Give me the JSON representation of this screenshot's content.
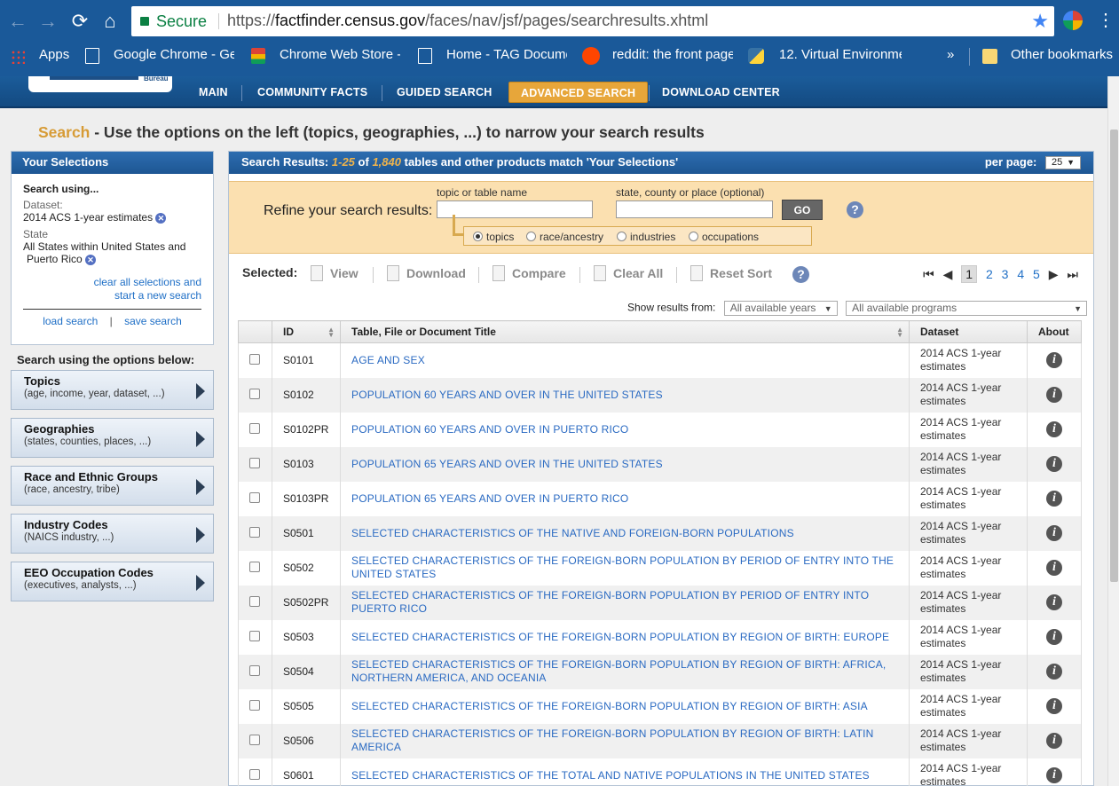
{
  "browser": {
    "secure_label": "Secure",
    "url_scheme": "https://",
    "url_host": "factfinder.census.gov",
    "url_path": "/faces/nav/jsf/pages/searchresults.xhtml",
    "bookmarks": [
      {
        "label": "Apps"
      },
      {
        "label": "Google Chrome - Ge"
      },
      {
        "label": "Chrome Web Store -"
      },
      {
        "label": "Home - TAG Docume"
      },
      {
        "label": "reddit: the front page"
      },
      {
        "label": "12. Virtual Environme"
      },
      {
        "label": "»"
      },
      {
        "label": "Other bookmarks"
      }
    ]
  },
  "site": {
    "logo_text": "Bureau",
    "nav": [
      "MAIN",
      "COMMUNITY FACTS",
      "GUIDED SEARCH",
      "ADVANCED SEARCH",
      "DOWNLOAD CENTER"
    ]
  },
  "heading": {
    "accent": "Search",
    "text": " - Use the options on the left (topics, geographies, ...) to narrow your search results"
  },
  "selections": {
    "title": "Your Selections",
    "search_using": "Search using...",
    "dataset_label": "Dataset:",
    "dataset_value": "2014 ACS 1-year estimates",
    "state_label": "State",
    "state_value_1": "All States within United States and",
    "state_value_2": "Puerto Rico",
    "clear_1": "clear all selections and",
    "clear_2": "start a new search",
    "load": "load search",
    "sep": "|",
    "save": "save search"
  },
  "options": {
    "heading": "Search using the options below:",
    "items": [
      {
        "title": "Topics",
        "sub": "(age, income, year, dataset, ...)"
      },
      {
        "title": "Geographies",
        "sub": "(states, counties, places, ...)"
      },
      {
        "title": "Race and Ethnic Groups",
        "sub": "(race, ancestry, tribe)"
      },
      {
        "title": "Industry Codes",
        "sub": "(NAICS industry, ...)"
      },
      {
        "title": "EEO Occupation Codes",
        "sub": "(executives, analysts, ...)"
      }
    ]
  },
  "results": {
    "label": "Search Results:",
    "range": "1-25",
    "of": "of",
    "total": "1,840",
    "suffix": "tables and other products match 'Your Selections'",
    "per_page_label": "per page:",
    "per_page_value": "25"
  },
  "refine": {
    "label": "Refine your search results:",
    "topic_caption": "topic or table name",
    "geo_caption": "state, county or place (optional)",
    "go": "GO",
    "radios": [
      {
        "label": "topics",
        "checked": true
      },
      {
        "label": "race/ancestry",
        "checked": false
      },
      {
        "label": "industries",
        "checked": false
      },
      {
        "label": "occupations",
        "checked": false
      }
    ]
  },
  "actions": {
    "selected": "Selected:",
    "view": "View",
    "download": "Download",
    "compare": "Compare",
    "clear_all": "Clear All",
    "reset_sort": "Reset Sort",
    "pages": [
      "1",
      "2",
      "3",
      "4",
      "5"
    ]
  },
  "filters": {
    "label": "Show results from:",
    "years": "All available years",
    "programs": "All available programs"
  },
  "table": {
    "columns": [
      "ID",
      "Table, File or Document Title",
      "Dataset",
      "About"
    ],
    "rows": [
      {
        "id": "S0101",
        "title": "AGE AND SEX",
        "ds1": "2014 ACS 1-year",
        "ds2": "estimates"
      },
      {
        "id": "S0102",
        "title": "POPULATION 60 YEARS AND OVER IN THE UNITED STATES",
        "ds1": "2014 ACS 1-year",
        "ds2": "estimates"
      },
      {
        "id": "S0102PR",
        "title": "POPULATION 60 YEARS AND OVER IN PUERTO RICO",
        "ds1": "2014 ACS 1-year",
        "ds2": "estimates"
      },
      {
        "id": "S0103",
        "title": "POPULATION 65 YEARS AND OVER IN THE UNITED STATES",
        "ds1": "2014 ACS 1-year",
        "ds2": "estimates"
      },
      {
        "id": "S0103PR",
        "title": "POPULATION 65 YEARS AND OVER IN PUERTO RICO",
        "ds1": "2014 ACS 1-year",
        "ds2": "estimates"
      },
      {
        "id": "S0501",
        "title": "SELECTED CHARACTERISTICS OF THE NATIVE AND FOREIGN-BORN POPULATIONS",
        "ds1": "2014 ACS 1-year",
        "ds2": "estimates"
      },
      {
        "id": "S0502",
        "title": "SELECTED CHARACTERISTICS OF THE FOREIGN-BORN POPULATION BY PERIOD OF ENTRY INTO THE UNITED STATES",
        "ds1": "2014 ACS 1-year",
        "ds2": "estimates"
      },
      {
        "id": "S0502PR",
        "title": "SELECTED CHARACTERISTICS OF THE FOREIGN-BORN POPULATION BY PERIOD OF ENTRY INTO PUERTO RICO",
        "ds1": "2014 ACS 1-year",
        "ds2": "estimates"
      },
      {
        "id": "S0503",
        "title": "SELECTED CHARACTERISTICS OF THE FOREIGN-BORN POPULATION BY REGION OF BIRTH: EUROPE",
        "ds1": "2014 ACS 1-year",
        "ds2": "estimates"
      },
      {
        "id": "S0504",
        "title": "SELECTED CHARACTERISTICS OF THE FOREIGN-BORN POPULATION BY REGION OF BIRTH: AFRICA, NORTHERN AMERICA, AND OCEANIA",
        "ds1": "2014 ACS 1-year",
        "ds2": "estimates"
      },
      {
        "id": "S0505",
        "title": "SELECTED CHARACTERISTICS OF THE FOREIGN-BORN POPULATION BY REGION OF BIRTH: ASIA",
        "ds1": "2014 ACS 1-year",
        "ds2": "estimates"
      },
      {
        "id": "S0506",
        "title": "SELECTED CHARACTERISTICS OF THE FOREIGN-BORN POPULATION BY REGION OF BIRTH: LATIN AMERICA",
        "ds1": "2014 ACS 1-year",
        "ds2": "estimates"
      },
      {
        "id": "S0601",
        "title": "SELECTED CHARACTERISTICS OF THE TOTAL AND NATIVE POPULATIONS IN THE UNITED STATES",
        "ds1": "2014 ACS 1-year",
        "ds2": "estimates"
      }
    ]
  },
  "colors": {
    "chrome_blue": "#1a5999",
    "nav_blue": "#1b5c9a",
    "accent_orange": "#e7a63a",
    "link_blue": "#2a6ac2",
    "refine_bg": "#fbe0b0"
  }
}
